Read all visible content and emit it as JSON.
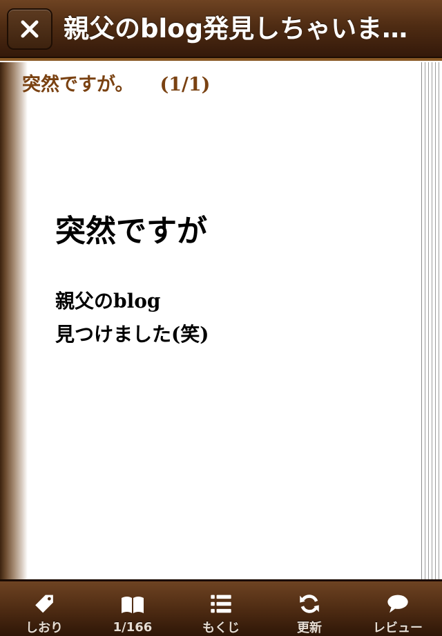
{
  "navbar": {
    "title": "親父のblog発見しちゃいました",
    "close_icon": "close-icon"
  },
  "page": {
    "chapter_title": "突然ですが。",
    "chapter_page": "(1/1)",
    "body_heading": "突然ですが",
    "body_lines": [
      "親父のblog",
      "見つけました(笑)"
    ]
  },
  "tabbar": {
    "tabs": [
      {
        "label": "しおり",
        "icon": "bookmark-tag-icon"
      },
      {
        "label": "1/166",
        "icon": "open-book-icon"
      },
      {
        "label": "もくじ",
        "icon": "list-icon"
      },
      {
        "label": "更新",
        "icon": "refresh-icon"
      },
      {
        "label": "レビュー",
        "icon": "speech-bubble-icon"
      }
    ]
  },
  "colors": {
    "bar_brown": "#4f2c13",
    "heading_brown": "#7a4212",
    "text": "#000000",
    "tab_label": "#e6dcd2"
  }
}
